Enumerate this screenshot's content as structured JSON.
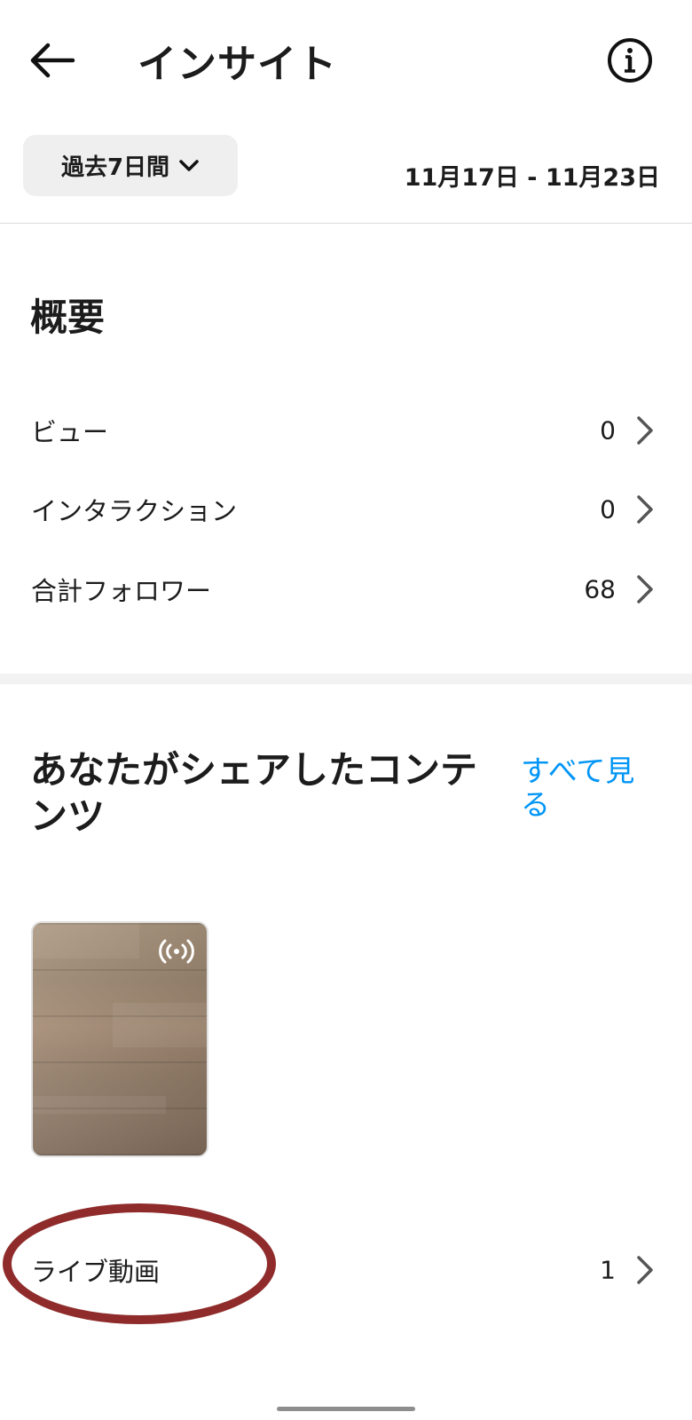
{
  "header": {
    "title": "インサイト",
    "back_icon": "arrow-left-icon",
    "info_icon": "info-icon"
  },
  "filter": {
    "period_label": "過去7日間",
    "date_range": "11月17日 - 11月23日"
  },
  "overview": {
    "title": "概要",
    "rows": [
      {
        "label": "ビュー",
        "value": "0"
      },
      {
        "label": "インタラクション",
        "value": "0"
      },
      {
        "label": "合計フォロワー",
        "value": "68"
      }
    ]
  },
  "content": {
    "title": "あなたがシェアしたコンテンツ",
    "see_all": "すべて見る",
    "live_row": {
      "label": "ライブ動画",
      "value": "1"
    }
  },
  "colors": {
    "accent": "#0095f6",
    "annotation": "#8f2b2b"
  }
}
